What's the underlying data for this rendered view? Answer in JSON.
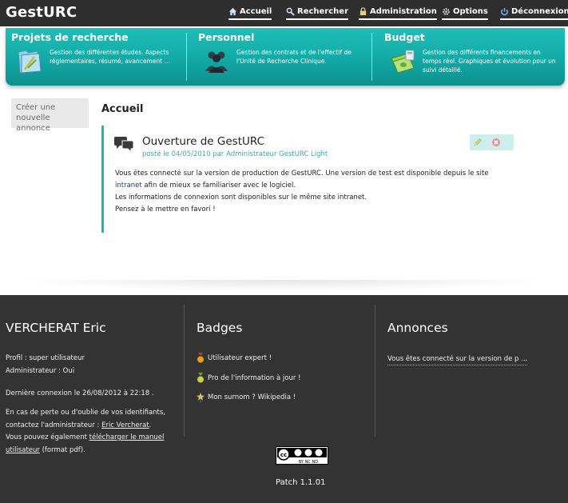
{
  "app": {
    "logo": "GestURC"
  },
  "nav": [
    {
      "label": "Accueil",
      "icon": "home-icon"
    },
    {
      "label": "Rechercher",
      "icon": "search-icon"
    },
    {
      "label": "Administration",
      "icon": "lock-icon"
    },
    {
      "label": "Options",
      "icon": "gear-icon"
    },
    {
      "label": "Déconnexion",
      "icon": "power-icon"
    }
  ],
  "banner": [
    {
      "title": "Projets de recherche",
      "desc": "Gestion des différentes études. Aspects réglementaires, résumé, avancement ...",
      "icon": "folder-icon"
    },
    {
      "title": "Personnel",
      "desc": "Gestion des contrats et de l'effectif de l'Unité de Recherche Clinique.",
      "icon": "people-icon"
    },
    {
      "title": "Budget",
      "desc": "Gestion des différents financements en temps réel. Graphiques et évolution pour un suivi détaillé.",
      "icon": "money-icon"
    }
  ],
  "sidebar": {
    "create_label": "Créer une nouvelle annonce"
  },
  "main": {
    "title": "Accueil",
    "post": {
      "title": "Ouverture de GestURC",
      "meta": "posté le 04/05/2010 par Administrateur GestURC Light",
      "line1_a": "Vous êtes connecté sur la version de production de GestURC. Une version de test est disponible depuis le site",
      "link": "intranet",
      "line1_b": " afin de mieux se familiariser avec le logiciel.",
      "line2": "Les informations de connexion sont disponibles sur le même site intranet.",
      "line3": "Pensez à le mettre en favori !"
    }
  },
  "footer": {
    "user": {
      "name": "VERCHERAT Eric",
      "profil": "Profil : super utilisateur",
      "admin": "Administrateur : Oui",
      "last_login": "Dernière connexion le 26/08/2012 à 22:18 .",
      "help_a": "En cas de perte ou d'oublie de vos identifiants,",
      "help_b": "contactez l'administrateur : ",
      "admin_link": "Eric Vercherat",
      "help_c": "Vous pouvez également ",
      "manual_link_a": "télécharger le manuel",
      "manual_link_b": "utilisateur",
      "help_d": " (format pdf)."
    },
    "badges": {
      "title": "Badges",
      "items": [
        {
          "label": "Utilisateur expert !",
          "color": "#e3a21a"
        },
        {
          "label": "Pro de l'information à jour !",
          "color": "#c9d33a"
        },
        {
          "label": "Mon surnom ? Wikipedia !",
          "color": "#d8c26a"
        }
      ]
    },
    "annonces": {
      "title": "Annonces",
      "item": "Vous êtes connecté sur la version de p ..."
    },
    "license": "BY NC ND",
    "patch": "Patch 1.1.01"
  },
  "colors": {
    "accent": "#1fbfb8",
    "topbar": "#2e2e2e",
    "footer": "#333333"
  }
}
